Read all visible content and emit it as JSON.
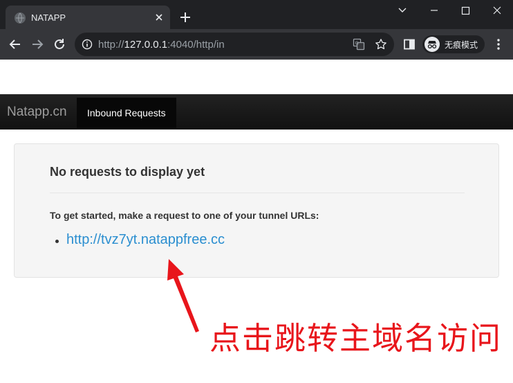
{
  "browser": {
    "tab_title": "NATAPP",
    "url_prefix": "http://",
    "url_host": "127.0.0.1",
    "url_rest": ":4040/http/in",
    "incognito_label": "无痕模式"
  },
  "page": {
    "brand": "Natapp.cn",
    "nav_active": "Inbound Requests",
    "heading": "No requests to display yet",
    "instruction": "To get started, make a request to one of your tunnel URLs:",
    "tunnel_url": "http://tvz7yt.natappfree.cc",
    "link_color": "#2a8ed0"
  },
  "annotation": {
    "text": "点击跳转主域名访问",
    "color": "#e8151b"
  },
  "icons": [
    "globe-icon",
    "close-icon",
    "plus-icon",
    "minimize-icon",
    "maximize-icon",
    "window-close-icon",
    "back-icon",
    "forward-icon",
    "reload-icon",
    "info-icon",
    "translate-icon",
    "star-icon",
    "side-panel-icon",
    "incognito-icon",
    "more-icon"
  ]
}
